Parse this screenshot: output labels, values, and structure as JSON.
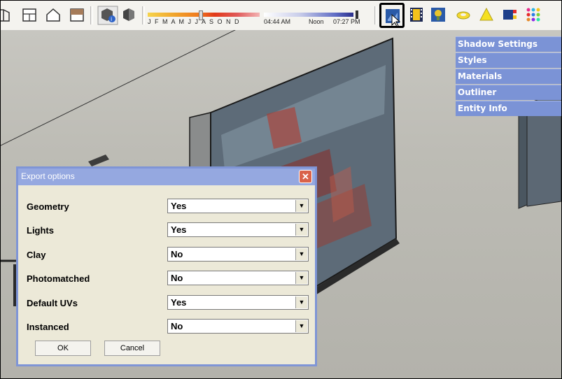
{
  "toolbar": {
    "months_label": "J F M A M J J A S O N D",
    "time_start": "04:44 AM",
    "time_mid": "Noon",
    "time_end": "07:27 PM"
  },
  "tray": {
    "items": [
      {
        "label": "Shadow Settings"
      },
      {
        "label": "Styles"
      },
      {
        "label": "Materials"
      },
      {
        "label": "Outliner"
      },
      {
        "label": "Entity Info"
      }
    ]
  },
  "dialog": {
    "title": "Export options",
    "close_label": "✕",
    "options": [
      {
        "label": "Geometry",
        "value": "Yes"
      },
      {
        "label": "Lights",
        "value": "Yes"
      },
      {
        "label": "Clay",
        "value": "No"
      },
      {
        "label": "Photomatched",
        "value": "No"
      },
      {
        "label": "Default UVs",
        "value": "Yes"
      },
      {
        "label": "Instanced",
        "value": "No"
      }
    ],
    "ok_label": "OK",
    "cancel_label": "Cancel"
  },
  "colors": {
    "tray_bg": "#7b93d6",
    "dialog_title_bg": "#95a8e0",
    "dialog_bg": "#ece9d8",
    "close_button": "#d9624a"
  },
  "icons": [
    "front-view-icon",
    "back-view-icon",
    "home-icon",
    "left-view-icon",
    "entity-info-icon",
    "shadow-toggle-icon",
    "shadows-dialog-icon",
    "film-icon",
    "component-icon",
    "ring-icon",
    "cone-icon",
    "material-icon",
    "palette-icon"
  ]
}
